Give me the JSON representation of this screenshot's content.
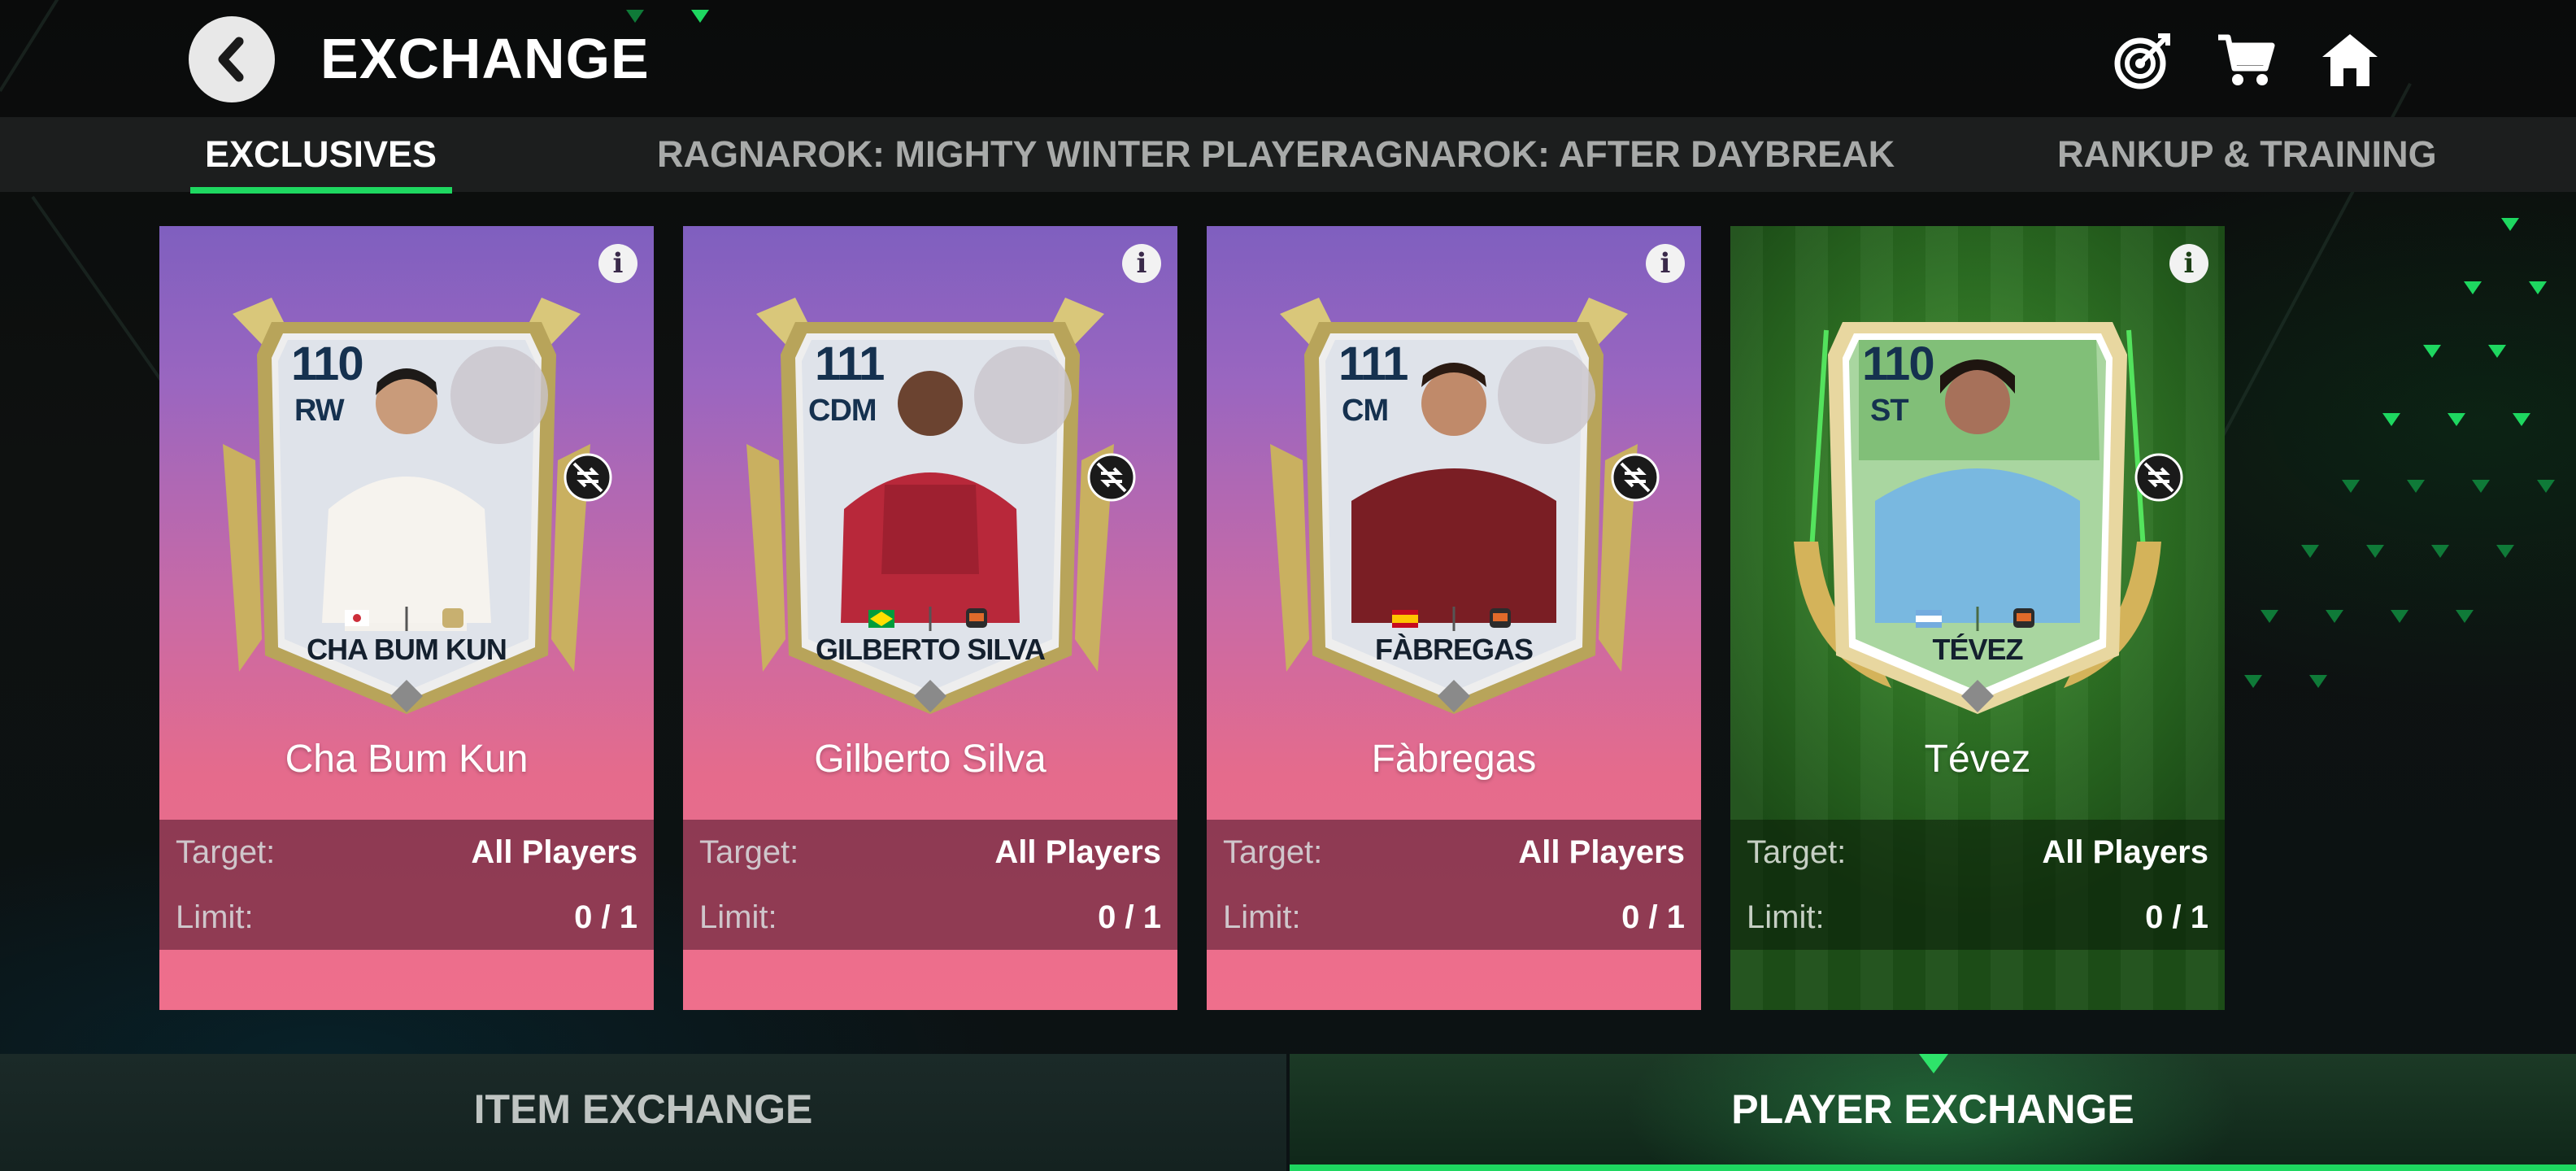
{
  "header": {
    "title": "EXCHANGE",
    "back_icon": "chevron-left-icon",
    "icons": [
      "target-icon",
      "cart-icon",
      "home-icon"
    ]
  },
  "tabs": [
    {
      "label": "EXCLUSIVES",
      "active": true
    },
    {
      "label": "RAGNAROK: MIGHTY WINTER PLAYER",
      "active": false
    },
    {
      "label": "RAGNAROK: AFTER DAYBREAK",
      "active": false
    },
    {
      "label": "RANKUP & TRAINING",
      "active": false
    }
  ],
  "cards": [
    {
      "rating": "110",
      "position": "RW",
      "card_name": "CHA BUM KUN",
      "display_name": "Cha Bum Kun",
      "flag": "south-korea-flag-icon",
      "target_label": "Target:",
      "target_value": "All Players",
      "limit_label": "Limit:",
      "limit_value": "0 / 1"
    },
    {
      "rating": "111",
      "position": "CDM",
      "card_name": "GILBERTO SILVA",
      "display_name": "Gilberto Silva",
      "flag": "brazil-flag-icon",
      "target_label": "Target:",
      "target_value": "All Players",
      "limit_label": "Limit:",
      "limit_value": "0 / 1"
    },
    {
      "rating": "111",
      "position": "CM",
      "card_name": "FÀBREGAS",
      "display_name": "Fàbregas",
      "flag": "spain-flag-icon",
      "target_label": "Target:",
      "target_value": "All Players",
      "limit_label": "Limit:",
      "limit_value": "0 / 1"
    },
    {
      "rating": "110",
      "position": "ST",
      "card_name": "TÉVEZ",
      "display_name": "Tévez",
      "flag": "argentina-flag-icon",
      "target_label": "Target:",
      "target_value": "All Players",
      "limit_label": "Limit:",
      "limit_value": "0 / 1"
    }
  ],
  "bottom_nav": {
    "item_exchange": "ITEM EXCHANGE",
    "player_exchange": "PLAYER EXCHANGE",
    "active": "player_exchange"
  },
  "colors": {
    "accent": "#1ed760",
    "card_purple_top": "#7f5fbf",
    "card_pink_bottom": "#ef6f8c",
    "card_green": "#2b6d22",
    "rating_text": "#15314f"
  }
}
